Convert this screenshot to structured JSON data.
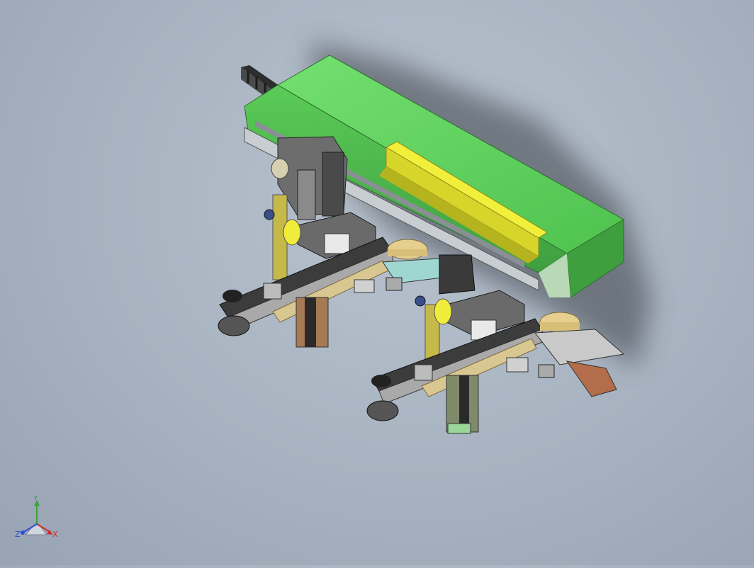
{
  "viewport": {
    "colors": {
      "background": "#a9b4c2",
      "housing": "#5ccf5a",
      "housing_dark": "#3f9f3f",
      "rail_yellow": "#e4e22a",
      "carriage": "#6d6d6d",
      "wood_arm": "#d8c790",
      "tan_disc": "#e6cf8e",
      "teal_plate": "#9fd7d0",
      "copper": "#b36d4a"
    }
  },
  "triad": {
    "y_label": "Y",
    "z_label": "Z",
    "x_label": "X",
    "colors": {
      "x": "#d22b2b",
      "y": "#3aa33a",
      "z": "#2a4fd2"
    }
  }
}
